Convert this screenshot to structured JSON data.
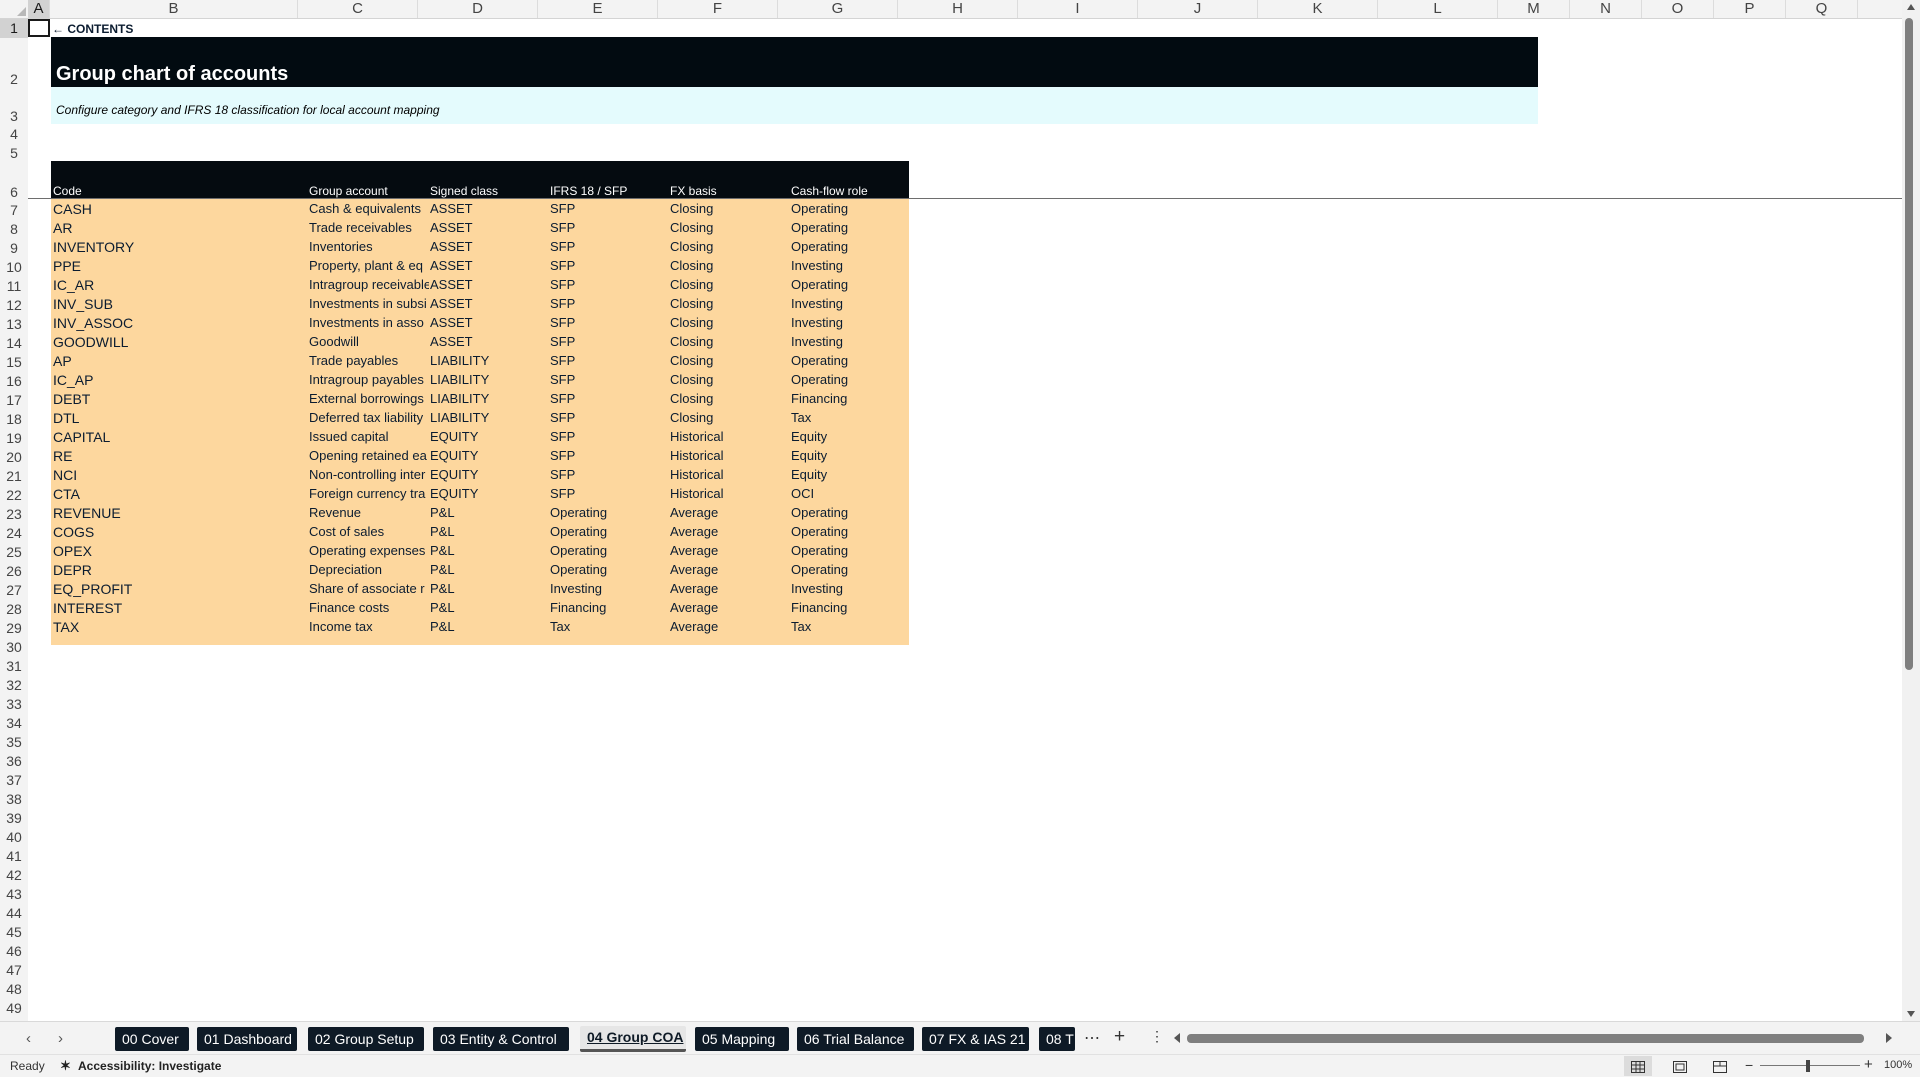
{
  "grid": {
    "columns": [
      "A",
      "B",
      "C",
      "D",
      "E",
      "F",
      "G",
      "H",
      "I",
      "J",
      "K",
      "L",
      "M",
      "N",
      "O",
      "P",
      "Q"
    ],
    "rows": [
      "1",
      "2",
      "3",
      "4",
      "5",
      "6",
      "7",
      "8",
      "9",
      "10",
      "11",
      "12",
      "13",
      "14",
      "15",
      "16",
      "17",
      "18",
      "19",
      "20",
      "21",
      "22",
      "23",
      "24",
      "25",
      "26",
      "27",
      "28",
      "29",
      "30",
      "31",
      "32",
      "33",
      "34",
      "35",
      "36",
      "37",
      "38",
      "39",
      "40",
      "41",
      "42",
      "43",
      "44",
      "45",
      "46",
      "47",
      "48",
      "49"
    ],
    "active_column": "A",
    "active_row": "1"
  },
  "sheet": {
    "contents_link": "← CONTENTS",
    "title": "Group chart of accounts",
    "subtitle": "Configure category and IFRS 18 classification for local account mapping"
  },
  "table": {
    "headers": [
      "Code",
      "Group account",
      "Signed class",
      "IFRS 18 / SFP",
      "FX basis",
      "Cash-flow role"
    ],
    "rows": [
      [
        "CASH",
        "Cash & equivalents",
        "ASSET",
        "SFP",
        "Closing",
        "Operating"
      ],
      [
        "AR",
        "Trade receivables",
        "ASSET",
        "SFP",
        "Closing",
        "Operating"
      ],
      [
        "INVENTORY",
        "Inventories",
        "ASSET",
        "SFP",
        "Closing",
        "Operating"
      ],
      [
        "PPE",
        "Property, plant & eq",
        "ASSET",
        "SFP",
        "Closing",
        "Investing"
      ],
      [
        "IC_AR",
        "Intragroup receivable",
        "ASSET",
        "SFP",
        "Closing",
        "Operating"
      ],
      [
        "INV_SUB",
        "Investments in subsi",
        "ASSET",
        "SFP",
        "Closing",
        "Investing"
      ],
      [
        "INV_ASSOC",
        "Investments in asso",
        "ASSET",
        "SFP",
        "Closing",
        "Investing"
      ],
      [
        "GOODWILL",
        "Goodwill",
        "ASSET",
        "SFP",
        "Closing",
        "Investing"
      ],
      [
        "AP",
        "Trade payables",
        "LIABILITY",
        "SFP",
        "Closing",
        "Operating"
      ],
      [
        "IC_AP",
        "Intragroup payables",
        "LIABILITY",
        "SFP",
        "Closing",
        "Operating"
      ],
      [
        "DEBT",
        "External borrowings",
        "LIABILITY",
        "SFP",
        "Closing",
        "Financing"
      ],
      [
        "DTL",
        "Deferred tax liability",
        "LIABILITY",
        "SFP",
        "Closing",
        "Tax"
      ],
      [
        "CAPITAL",
        "Issued capital",
        "EQUITY",
        "SFP",
        "Historical",
        "Equity"
      ],
      [
        "RE",
        "Opening retained ea",
        "EQUITY",
        "SFP",
        "Historical",
        "Equity"
      ],
      [
        "NCI",
        "Non-controlling inter",
        "EQUITY",
        "SFP",
        "Historical",
        "Equity"
      ],
      [
        "CTA",
        "Foreign currency tra",
        "EQUITY",
        "SFP",
        "Historical",
        "OCI"
      ],
      [
        "REVENUE",
        "Revenue",
        "P&L",
        "Operating",
        "Average",
        "Operating"
      ],
      [
        "COGS",
        "Cost of sales",
        "P&L",
        "Operating",
        "Average",
        "Operating"
      ],
      [
        "OPEX",
        "Operating expenses",
        "P&L",
        "Operating",
        "Average",
        "Operating"
      ],
      [
        "DEPR",
        "Depreciation",
        "P&L",
        "Operating",
        "Average",
        "Operating"
      ],
      [
        "EQ_PROFIT",
        "Share of associate r",
        "P&L",
        "Investing",
        "Average",
        "Investing"
      ],
      [
        "INTEREST",
        "Finance costs",
        "P&L",
        "Financing",
        "Average",
        "Financing"
      ],
      [
        "TAX",
        "Income tax",
        "P&L",
        "Tax",
        "Average",
        "Tax"
      ]
    ]
  },
  "tabs": {
    "items": [
      "00 Cover",
      "01 Dashboard",
      "02 Group Setup",
      "03 Entity & Control",
      "04 Group COA",
      "05 Mapping",
      "06 Trial Balance",
      "07 FX & IAS 21",
      "08 T"
    ],
    "active": "04 Group COA",
    "more": "⋯",
    "add": "+",
    "options": "⋮",
    "prev": "‹",
    "next": "›"
  },
  "status": {
    "ready": "Ready",
    "accessibility": "Accessibility: Investigate",
    "zoom": "100%"
  },
  "colors": {
    "title_bg": "#020b11",
    "subtitle_bg": "#e4fbfd",
    "table_header_bg": "#050b10",
    "table_body_bg": "#fdd79e",
    "tab_bg": "#0e1a26"
  },
  "icons": {
    "accessibility": "accessibility-icon",
    "normal_view": "grid-view-icon",
    "page_layout": "page-layout-icon",
    "page_break": "page-break-icon"
  }
}
